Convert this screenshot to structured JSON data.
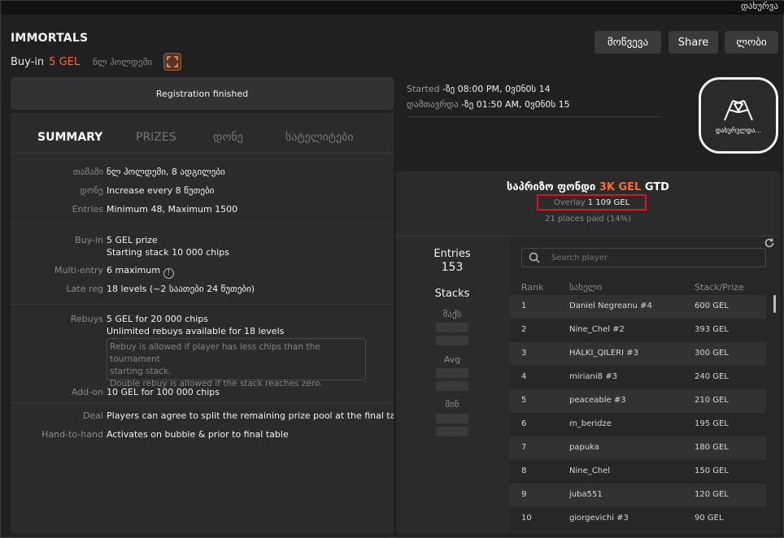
{
  "topbar": {
    "close_label": "დახურვა"
  },
  "header": {
    "title": "IMMORTALS",
    "buyin_label": "Buy-in",
    "buyin_price": "5 GEL",
    "game_type": "ნლ ჰოლდემი",
    "buttons": {
      "invite": "მოწვევა",
      "share": "Share",
      "lobby": "ლობი"
    }
  },
  "registration": {
    "status": "Registration finished"
  },
  "schedule": {
    "started_label": "Started",
    "started_value": "-ზე 08:00 PM, 0ვ0ნ0ს 14",
    "ended_label": "დამთავრდა",
    "ended_value": "-ზე 01:50 AM, 0ვ0ნ0ს 15"
  },
  "badge": {
    "label": "დახურულდა..."
  },
  "tabs": [
    {
      "label": "SUMMARY",
      "active": true
    },
    {
      "label": "PRIZES",
      "active": false
    },
    {
      "label": "დონე",
      "active": false
    },
    {
      "label": "სატელიტები",
      "active": false
    }
  ],
  "summary": {
    "game": {
      "k": "თამაში",
      "v": "ნლ ჰოლდემი, 8 ადგილები"
    },
    "level": {
      "k": "დონე",
      "v": "Increase every 8 წუთები"
    },
    "entries": {
      "k": "Entries",
      "v": "Minimum 48, Maximum 1500"
    },
    "buyin": {
      "k": "Buy-in",
      "v": "5 GEL prize",
      "v2": "Starting stack 10 000 chips"
    },
    "multientry": {
      "k": "Multi-entry",
      "v": "6 maximum"
    },
    "latereg": {
      "k": "Late reg",
      "v": "18 levels (~2 საათები 24 წუთები)"
    },
    "rebuys": {
      "k": "Rebuys",
      "v": "5 GEL for 20 000 chips",
      "v2": "Unlimited rebuys available for 18 levels",
      "note1": "Rebuy is allowed if player has less chips than the tournament",
      "note2": "starting stack.",
      "note3": "Double rebuy is allowed if the stack reaches zero."
    },
    "addon": {
      "k": "Add-on",
      "v": "10 GEL for 100 000 chips"
    },
    "deal": {
      "k": "Deal",
      "v": "Players can agree to split the remaining prize pool at the final table"
    },
    "handtohand": {
      "k": "Hand-to-hand",
      "v": "Activates on bubble & prior to final table"
    }
  },
  "prize": {
    "title_a": "საპრიზო ფონდი",
    "title_b": "3K GEL",
    "title_c": "GTD",
    "overlay_label": "Overlay",
    "overlay_value": "1 109 GEL",
    "places_paid": "21 places paid (14%)"
  },
  "stats": {
    "entries_label": "Entries",
    "entries_value": "153",
    "stacks_label": "Stacks",
    "max_label": "მაქს",
    "avg_label": "Avg",
    "min_label": "მინ"
  },
  "players": {
    "search_placeholder": "Search player",
    "headers": {
      "rank": "Rank",
      "name": "სახელი",
      "stack": "Stack/Prize"
    },
    "rows": [
      {
        "rank": "1",
        "name": "Daniel Negreanu #4",
        "prize": "600 GEL"
      },
      {
        "rank": "2",
        "name": "Nine_Chel #2",
        "prize": "393 GEL"
      },
      {
        "rank": "3",
        "name": "HALKI_QILERI #3",
        "prize": "300 GEL"
      },
      {
        "rank": "4",
        "name": "miriani8 #3",
        "prize": "240 GEL"
      },
      {
        "rank": "5",
        "name": "peaceable #3",
        "prize": "210 GEL"
      },
      {
        "rank": "6",
        "name": "m_beridze",
        "prize": "195 GEL"
      },
      {
        "rank": "7",
        "name": "papuka",
        "prize": "180 GEL"
      },
      {
        "rank": "8",
        "name": "Nine_Chel",
        "prize": "150 GEL"
      },
      {
        "rank": "9",
        "name": "juba551",
        "prize": "120 GEL"
      },
      {
        "rank": "10",
        "name": "giorgevichi #3",
        "prize": "90 GEL"
      }
    ]
  },
  "colors": {
    "accent": "#ff6a2a",
    "highlight_box": "#e0141a",
    "panel": "#2b2b2e"
  }
}
